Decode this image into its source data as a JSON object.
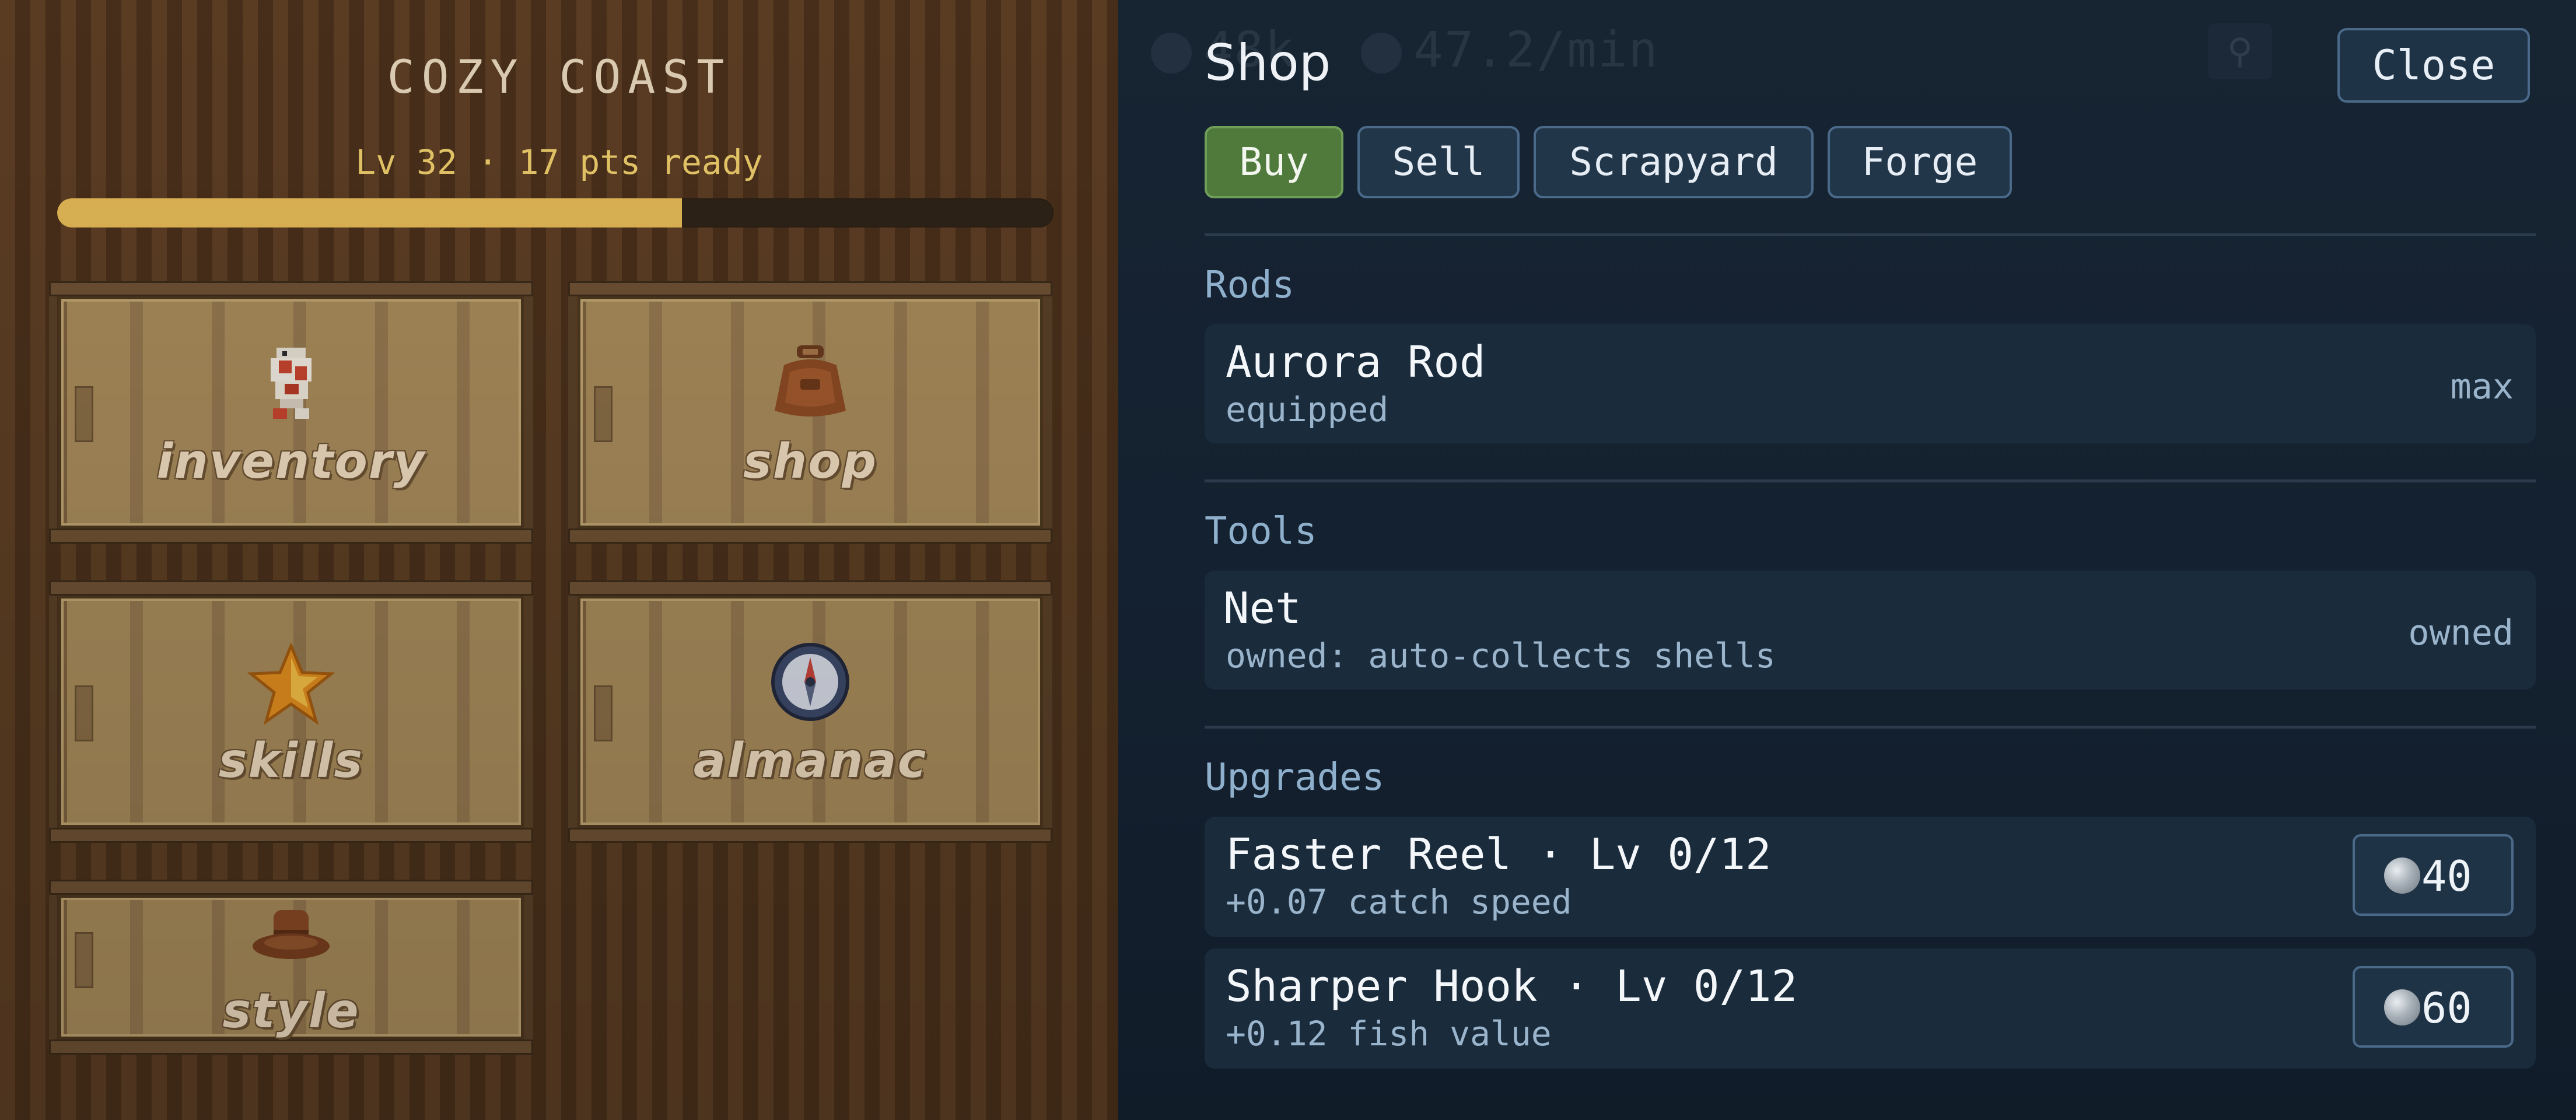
{
  "menu": {
    "area_title": "COZY COAST",
    "level_text": "Lv 32 · 17 pts ready",
    "xp_progress": 0.627,
    "tiles": [
      {
        "label": "inventory",
        "icon": "koi-fish-icon"
      },
      {
        "label": "shop",
        "icon": "bag-icon"
      },
      {
        "label": "skills",
        "icon": "star-icon"
      },
      {
        "label": "almanac",
        "icon": "compass-icon"
      },
      {
        "label": "style",
        "icon": "hat-icon"
      }
    ]
  },
  "shop": {
    "title": "Shop",
    "close_label": "Close",
    "tabs": [
      {
        "label": "Buy",
        "active": true
      },
      {
        "label": "Sell",
        "active": false
      },
      {
        "label": "Scrapyard",
        "active": false
      },
      {
        "label": "Forge",
        "active": false
      }
    ],
    "sections": {
      "rods": {
        "heading": "Rods",
        "items": [
          {
            "name": "Aurora Rod",
            "desc": "equipped",
            "status": "max"
          }
        ]
      },
      "tools": {
        "heading": "Tools",
        "items": [
          {
            "name": "Net",
            "desc": "owned: auto-collects shells",
            "status": "owned"
          }
        ]
      },
      "upgrades": {
        "heading": "Upgrades",
        "items": [
          {
            "name": "Faster Reel · Lv 0/12",
            "desc": "+0.07 catch speed",
            "price": "40",
            "currency_icon": "silver-coin-icon"
          },
          {
            "name": "Sharper Hook · Lv 0/12",
            "desc": "+0.12 fish value",
            "price": "60",
            "currency_icon": "silver-coin-icon"
          }
        ]
      }
    }
  },
  "background_hud": {
    "rate_text": "47.2/min",
    "count_text": "48k"
  },
  "colors": {
    "active_tab": "#4f7a3c",
    "xp_fill": "#e8bd58",
    "panel_bg": "#142130",
    "section_heading": "#8fb0cc"
  }
}
